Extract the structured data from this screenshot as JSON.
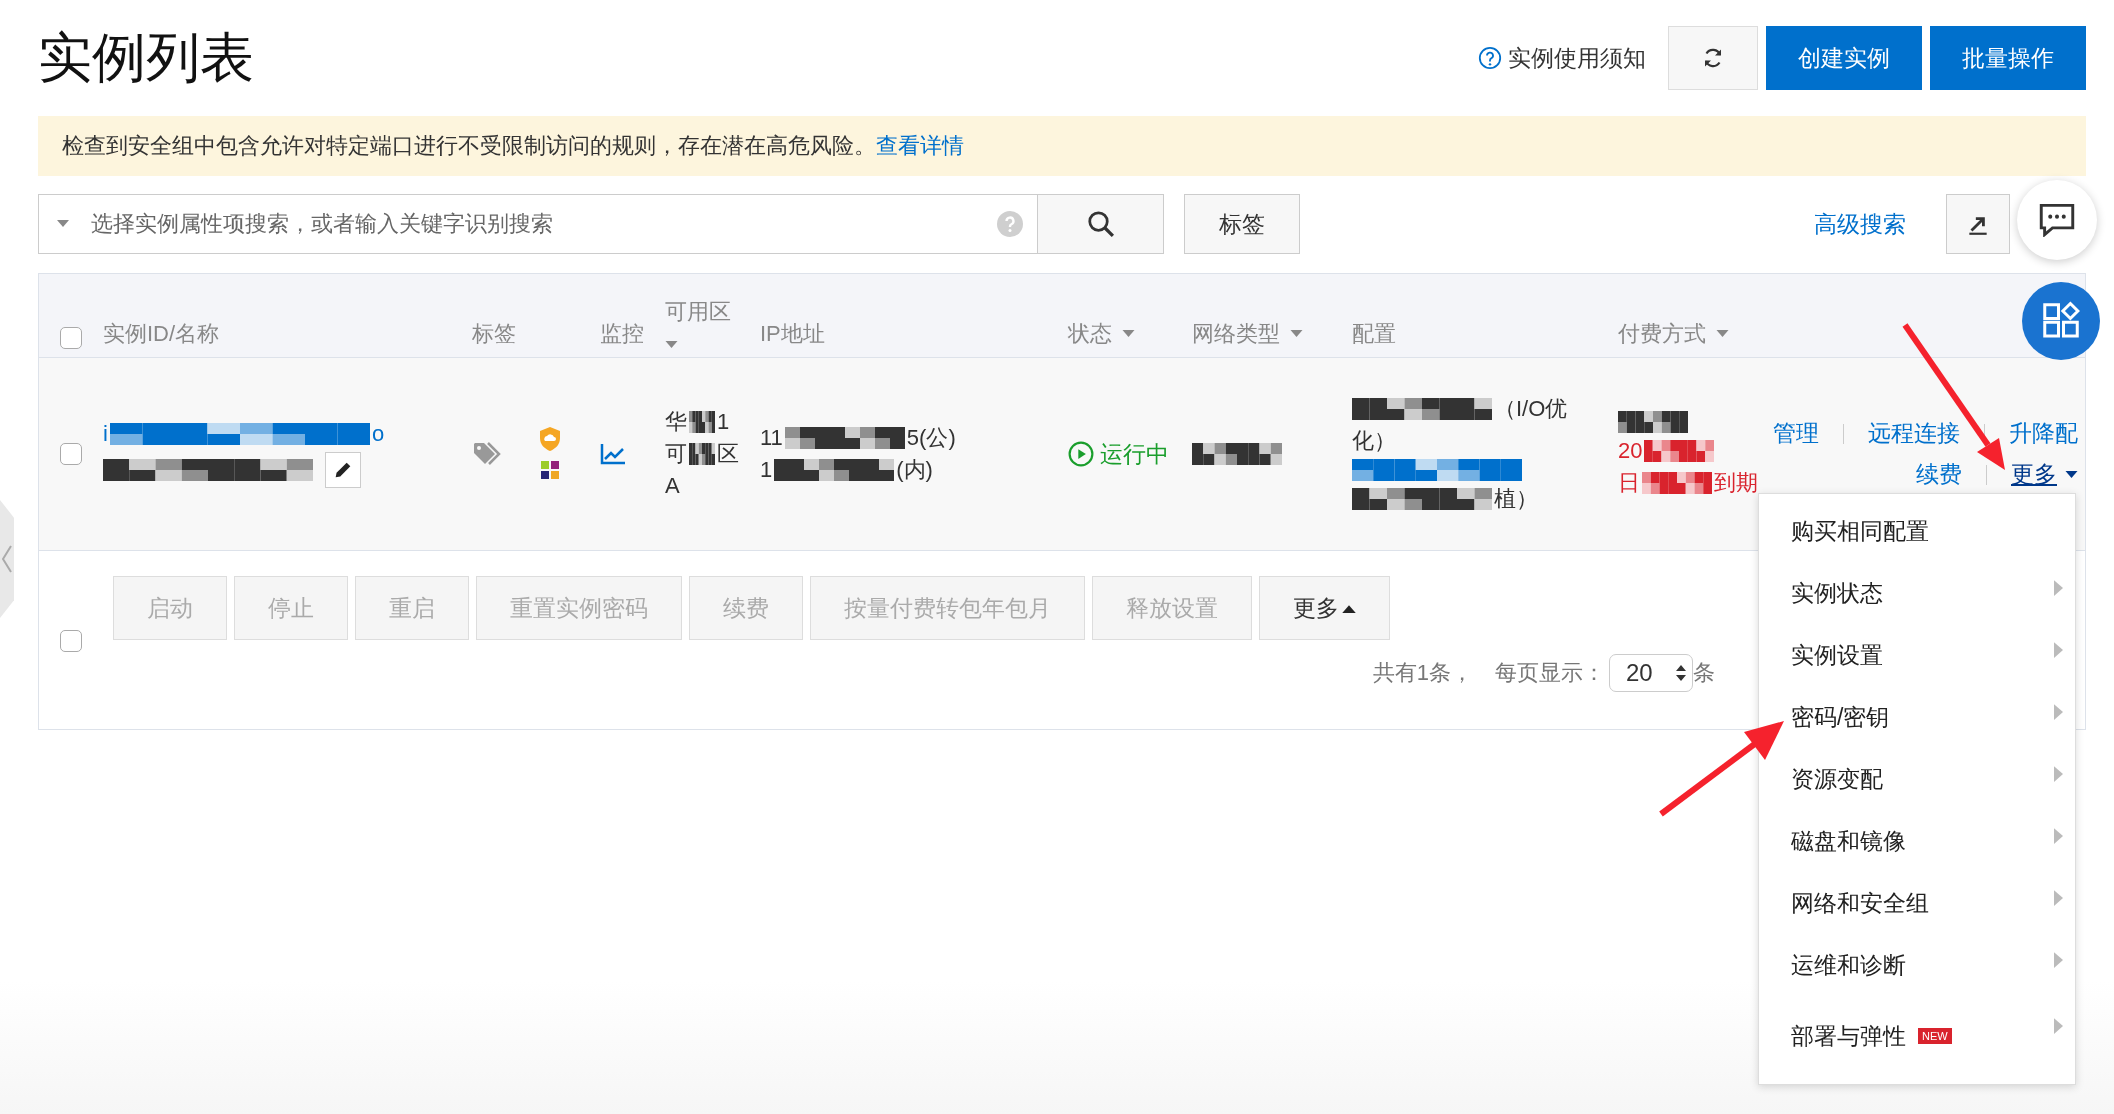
{
  "page": {
    "title": "实例列表"
  },
  "header_actions": {
    "help_link": "实例使用须知",
    "buttons": [
      {
        "label": "创建实例"
      },
      {
        "label": "批量操作"
      }
    ]
  },
  "alert": {
    "message": "检查到安全组中包含允许对特定端口进行不受限制访问的规则，存在潜在高危风险。",
    "link": "查看详情"
  },
  "search": {
    "placeholder": "选择实例属性项搜索，或者输入关键字识别搜索",
    "tag_button": "标签",
    "advanced_link": "高级搜索"
  },
  "table": {
    "select_all": {
      "checked": false
    },
    "columns": [
      {
        "label": "实例ID/名称",
        "dropdown": false
      },
      {
        "label": "标签",
        "dropdown": false
      },
      {
        "label": "监控",
        "dropdown": false
      },
      {
        "label": "可用区",
        "dropdown": true
      },
      {
        "label": "IP地址",
        "dropdown": false
      },
      {
        "label": "状态",
        "dropdown": true
      },
      {
        "label": "网络类型",
        "dropdown": true
      },
      {
        "label": "配置",
        "dropdown": false
      },
      {
        "label": "付费方式",
        "dropdown": true
      }
    ],
    "rows": [
      {
        "selected": false,
        "id_lines": [
          {
            "color": "#0070cc",
            "parts": [
              {
                "kind": "text",
                "text": "i"
              },
              {
                "kind": "redacted"
              },
              {
                "kind": "text",
                "text": "o"
              }
            ]
          },
          {
            "color": "#333333",
            "parts": [
              {
                "kind": "redacted"
              }
            ]
          }
        ],
        "zone_lines": [
          {
            "color": "#333333",
            "parts": [
              {
                "kind": "text",
                "text": "华"
              },
              {
                "kind": "redacted"
              },
              {
                "kind": "text",
                "text": "1"
              }
            ]
          },
          {
            "color": "#333333",
            "parts": [
              {
                "kind": "text",
                "text": "可"
              },
              {
                "kind": "redacted"
              },
              {
                "kind": "text",
                "text": "区"
              }
            ]
          },
          {
            "color": "#333333",
            "parts": [
              {
                "kind": "text",
                "text": "A"
              }
            ]
          }
        ],
        "ip_lines": [
          {
            "color": "#333333",
            "parts": [
              {
                "kind": "text",
                "text": "11"
              },
              {
                "kind": "redacted"
              },
              {
                "kind": "text",
                "text": "5(公)"
              }
            ]
          },
          {
            "color": "#333333",
            "parts": [
              {
                "kind": "text",
                "text": "1"
              },
              {
                "kind": "redacted"
              },
              {
                "kind": "text",
                "text": "(内)"
              }
            ]
          }
        ],
        "status": {
          "text": "运行中",
          "color": "#1a9e2c"
        },
        "network_lines": [
          {
            "color": "#333333",
            "parts": [
              {
                "kind": "redacted"
              }
            ]
          }
        ],
        "config_lines": [
          {
            "color": "#333333",
            "parts": [
              {
                "kind": "redacted"
              },
              {
                "kind": "text",
                "text": "（I/O优"
              }
            ]
          },
          {
            "color": "#333333",
            "parts": [
              {
                "kind": "text",
                "text": "化）"
              }
            ]
          },
          {
            "color": "#0070cc",
            "parts": [
              {
                "kind": "redacted"
              }
            ]
          },
          {
            "color": "#333333",
            "parts": [
              {
                "kind": "redacted"
              },
              {
                "kind": "text",
                "text": "植）"
              }
            ]
          }
        ],
        "payment_lines": [
          {
            "color": "#333333",
            "parts": [
              {
                "kind": "redacted"
              }
            ]
          },
          {
            "color": "#d9232d",
            "parts": [
              {
                "kind": "text",
                "text": "20"
              },
              {
                "kind": "redacted"
              }
            ]
          },
          {
            "color": "#d9232d",
            "parts": [
              {
                "kind": "text",
                "text": "日"
              },
              {
                "kind": "redacted"
              },
              {
                "kind": "text",
                "text": "到期"
              }
            ]
          }
        ],
        "action_lines": [
          [
            {
              "label": "管理",
              "kind": "link"
            },
            {
              "label": "远程连接",
              "kind": "link"
            },
            {
              "label": "升降配",
              "kind": "link"
            }
          ],
          [
            {
              "label": "续费",
              "kind": "link"
            },
            {
              "label": "更多",
              "kind": "menu",
              "expanded": true
            }
          ]
        ]
      }
    ]
  },
  "bulk_actions": {
    "checked": false,
    "buttons": [
      {
        "label": "启动",
        "disabled": true
      },
      {
        "label": "停止",
        "disabled": true
      },
      {
        "label": "重启",
        "disabled": true
      },
      {
        "label": "重置实例密码",
        "disabled": true
      },
      {
        "label": "续费",
        "disabled": true
      },
      {
        "label": "按量付费转包年包月",
        "disabled": true
      },
      {
        "label": "释放设置",
        "disabled": true
      },
      {
        "label": "更多",
        "disabled": false
      }
    ]
  },
  "pagination": {
    "total": "共有1条，",
    "page_size_label": "每页显示：",
    "page_size": "20",
    "unit": "条"
  },
  "more_menu": {
    "items": [
      {
        "label": "购买相同配置",
        "submenu": false
      },
      {
        "label": "实例状态",
        "submenu": true
      },
      {
        "label": "实例设置",
        "submenu": true
      },
      {
        "label": "密码/密钥",
        "submenu": true
      },
      {
        "label": "资源变配",
        "submenu": true
      },
      {
        "label": "磁盘和镜像",
        "submenu": true
      },
      {
        "label": "网络和安全组",
        "submenu": true
      },
      {
        "label": "运维和诊断",
        "submenu": true
      },
      {
        "label": "部署与弹性",
        "submenu": true,
        "badge": "NEW"
      }
    ]
  }
}
